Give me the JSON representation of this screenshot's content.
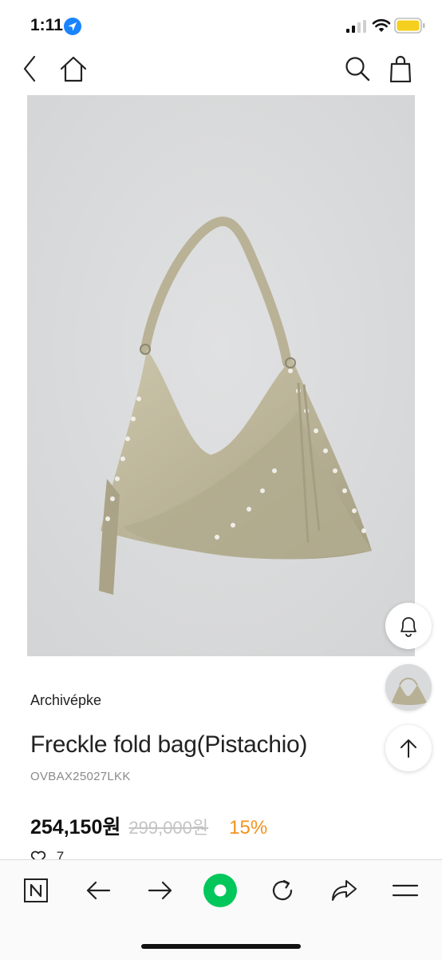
{
  "status_bar": {
    "time": "1:11"
  },
  "product": {
    "brand": "Archivépke",
    "title": "Freckle fold bag(Pistachio)",
    "code": "OVBAX25027LKK",
    "price": "254,150원",
    "original_price": "299,000원",
    "discount": "15%",
    "likes": "7"
  },
  "colors": {
    "accent": "#f2921d",
    "naver_green": "#03c75a",
    "bag": "#bcb59a"
  },
  "icons": {
    "top_nav": [
      "back-icon",
      "home-icon",
      "search-icon",
      "shopping-bag-icon"
    ],
    "floating": [
      "bell-icon",
      "arrow-up-icon"
    ],
    "toolbar": [
      "naver-n-icon",
      "arrow-left-icon",
      "arrow-right-icon",
      "naver-green-dot-icon",
      "refresh-icon",
      "share-icon",
      "menu-icon"
    ]
  }
}
